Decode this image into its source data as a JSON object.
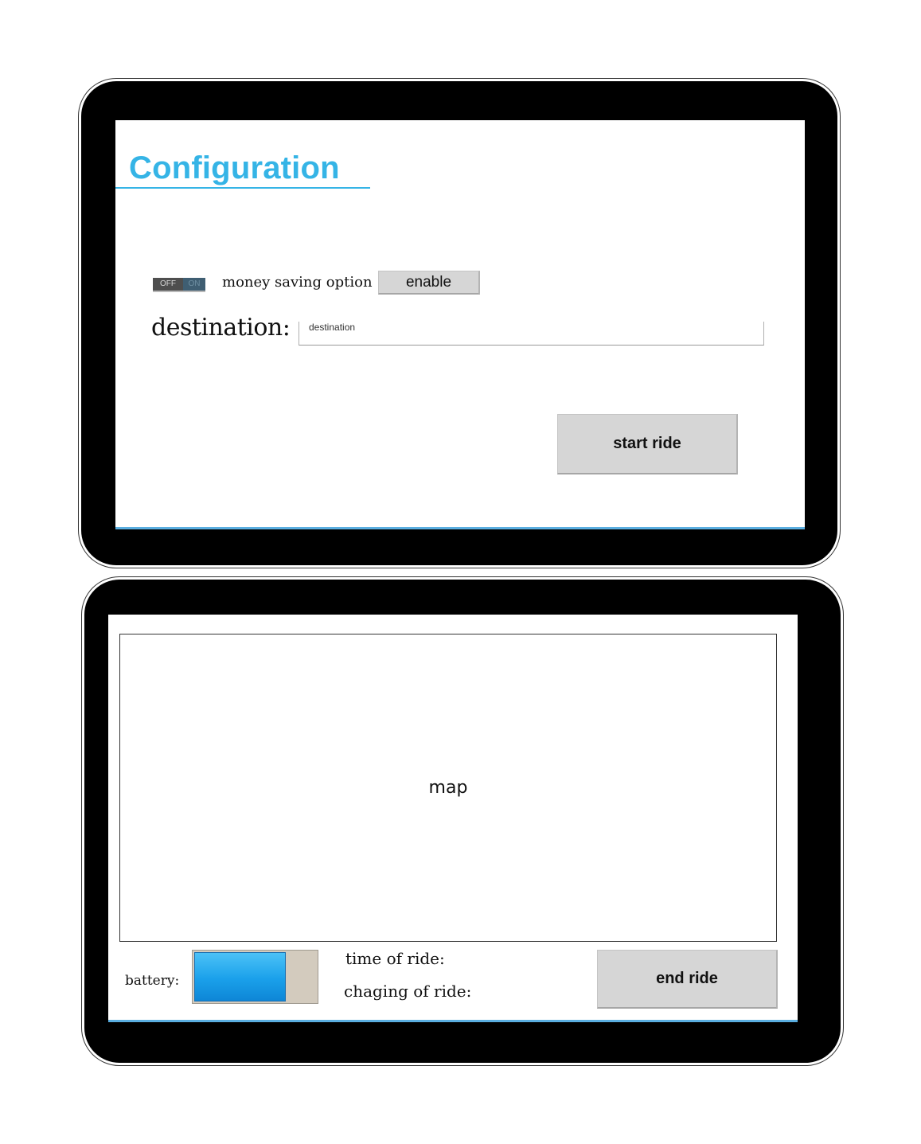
{
  "config_screen": {
    "title": "Configuration",
    "toggle": {
      "off_label": "OFF",
      "on_label": "ON",
      "state": "off"
    },
    "money_saving_label": "money saving option",
    "enable_button": "enable",
    "destination_label": "destination:",
    "destination_input": {
      "value": "",
      "placeholder": "destination"
    },
    "start_button": "start ride"
  },
  "ride_screen": {
    "map_label": "map",
    "battery_label": "battery:",
    "battery_level": 0.75,
    "time_of_ride_label": "time of ride:",
    "charging_of_ride_label": "chaging of ride:",
    "end_button": "end ride"
  },
  "colors": {
    "accent": "#35b4e6",
    "button_bg": "#d6d6d6",
    "battery_fill": "#1aa0ea",
    "battery_track": "#d3cbbe"
  }
}
